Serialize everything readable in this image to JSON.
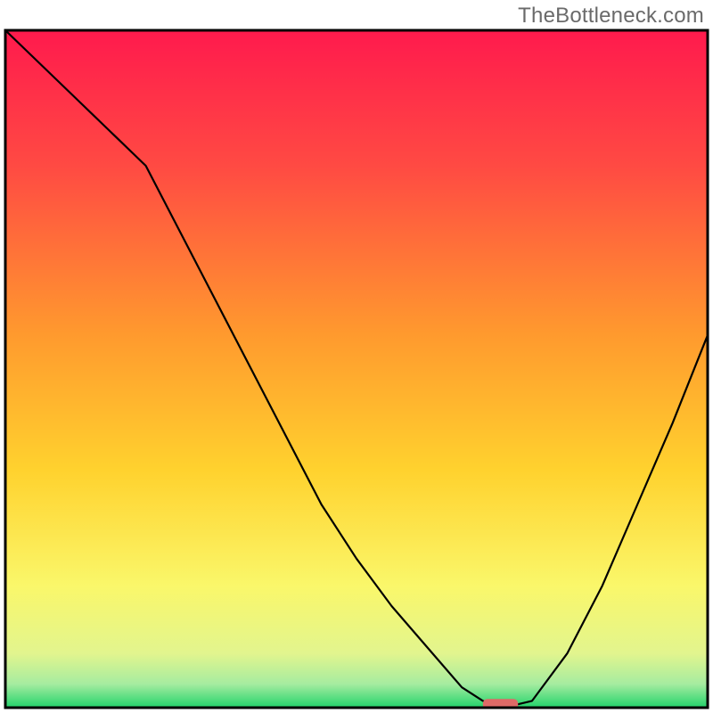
{
  "watermark": "TheBottleneck.com",
  "chart_data": {
    "type": "line",
    "title": "",
    "xlabel": "",
    "ylabel": "",
    "xlim": [
      0,
      100
    ],
    "ylim": [
      0,
      100
    ],
    "notes": "Unlabeled bottleneck curve over a vertical red→green gradient. Values are read off pixel positions (y=100 at top, y=0 at bottom).",
    "series": [
      {
        "name": "bottleneck-curve",
        "x": [
          0,
          5,
          10,
          15,
          20,
          25,
          30,
          35,
          40,
          45,
          50,
          55,
          60,
          65,
          68,
          70,
          73,
          75,
          80,
          85,
          90,
          95,
          100
        ],
        "y": [
          100,
          95,
          90,
          85,
          80,
          70,
          60,
          50,
          40,
          30,
          22,
          15,
          9,
          3,
          1,
          0.5,
          0.5,
          1,
          8,
          18,
          30,
          42,
          55
        ]
      }
    ],
    "annotations": [
      {
        "name": "min-marker",
        "x_start": 68,
        "x_end": 73,
        "y": 0.5
      }
    ],
    "gradient_stops": [
      {
        "pos": 0.0,
        "color": "#ff1a4d"
      },
      {
        "pos": 0.2,
        "color": "#ff4a43"
      },
      {
        "pos": 0.45,
        "color": "#ff9a2e"
      },
      {
        "pos": 0.65,
        "color": "#ffd22e"
      },
      {
        "pos": 0.82,
        "color": "#faf76a"
      },
      {
        "pos": 0.92,
        "color": "#e2f58e"
      },
      {
        "pos": 0.965,
        "color": "#a6eca0"
      },
      {
        "pos": 1.0,
        "color": "#23d36b"
      }
    ],
    "marker_color": "#de6a67",
    "curve_color": "#000000",
    "border_color": "#000000"
  }
}
